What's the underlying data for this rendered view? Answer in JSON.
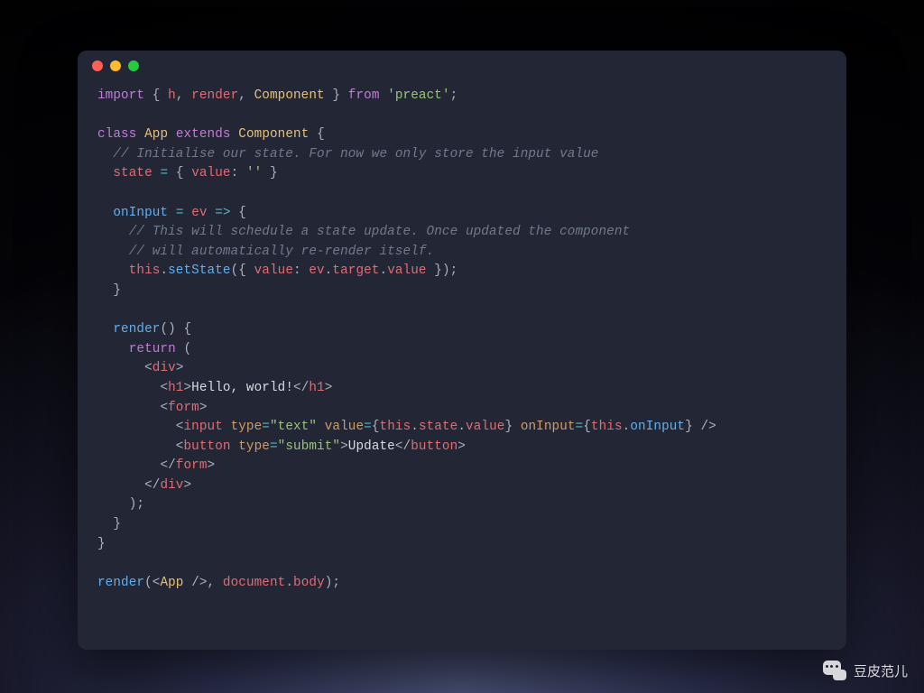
{
  "code": {
    "l1_import": "import",
    "l1_h": "h",
    "l1_render": "render",
    "l1_Component": "Component",
    "l1_from": "from",
    "l1_pkg": "'preact'",
    "l3_class": "class",
    "l3_App": "App",
    "l3_extends": "extends",
    "l3_Component": "Component",
    "l4_cm": "// Initialise our state. For now we only store the input value",
    "l5_state": "state",
    "l5_value": "value",
    "l5_empty": "''",
    "l7_onInput": "onInput",
    "l7_ev": "ev",
    "l8_cm": "// This will schedule a state update. Once updated the component",
    "l9_cm": "// will automatically re-render itself.",
    "l10_this": "this",
    "l10_setState": "setState",
    "l10_value": "value",
    "l10_ev": "ev",
    "l10_target": "target",
    "l10_valuep": "value",
    "l13_render": "render",
    "l14_return": "return",
    "l15_div": "div",
    "l16_h1": "h1",
    "l16_txt": "Hello, world!",
    "l17_form": "form",
    "l18_input": "input",
    "l18_type": "type",
    "l18_text": "\"text\"",
    "l18_value": "value",
    "l18_this": "this",
    "l18_state": "state",
    "l18_valp": "value",
    "l18_onInput": "onInput",
    "l18_onInputp": "onInput",
    "l19_button": "button",
    "l19_type": "type",
    "l19_submit": "\"submit\"",
    "l19_txt": "Update",
    "l20_form": "form",
    "l21_div": "div",
    "l25_render": "render",
    "l25_App": "App",
    "l25_document": "document",
    "l25_body": "body"
  },
  "watermark": {
    "text": "豆皮范儿"
  }
}
